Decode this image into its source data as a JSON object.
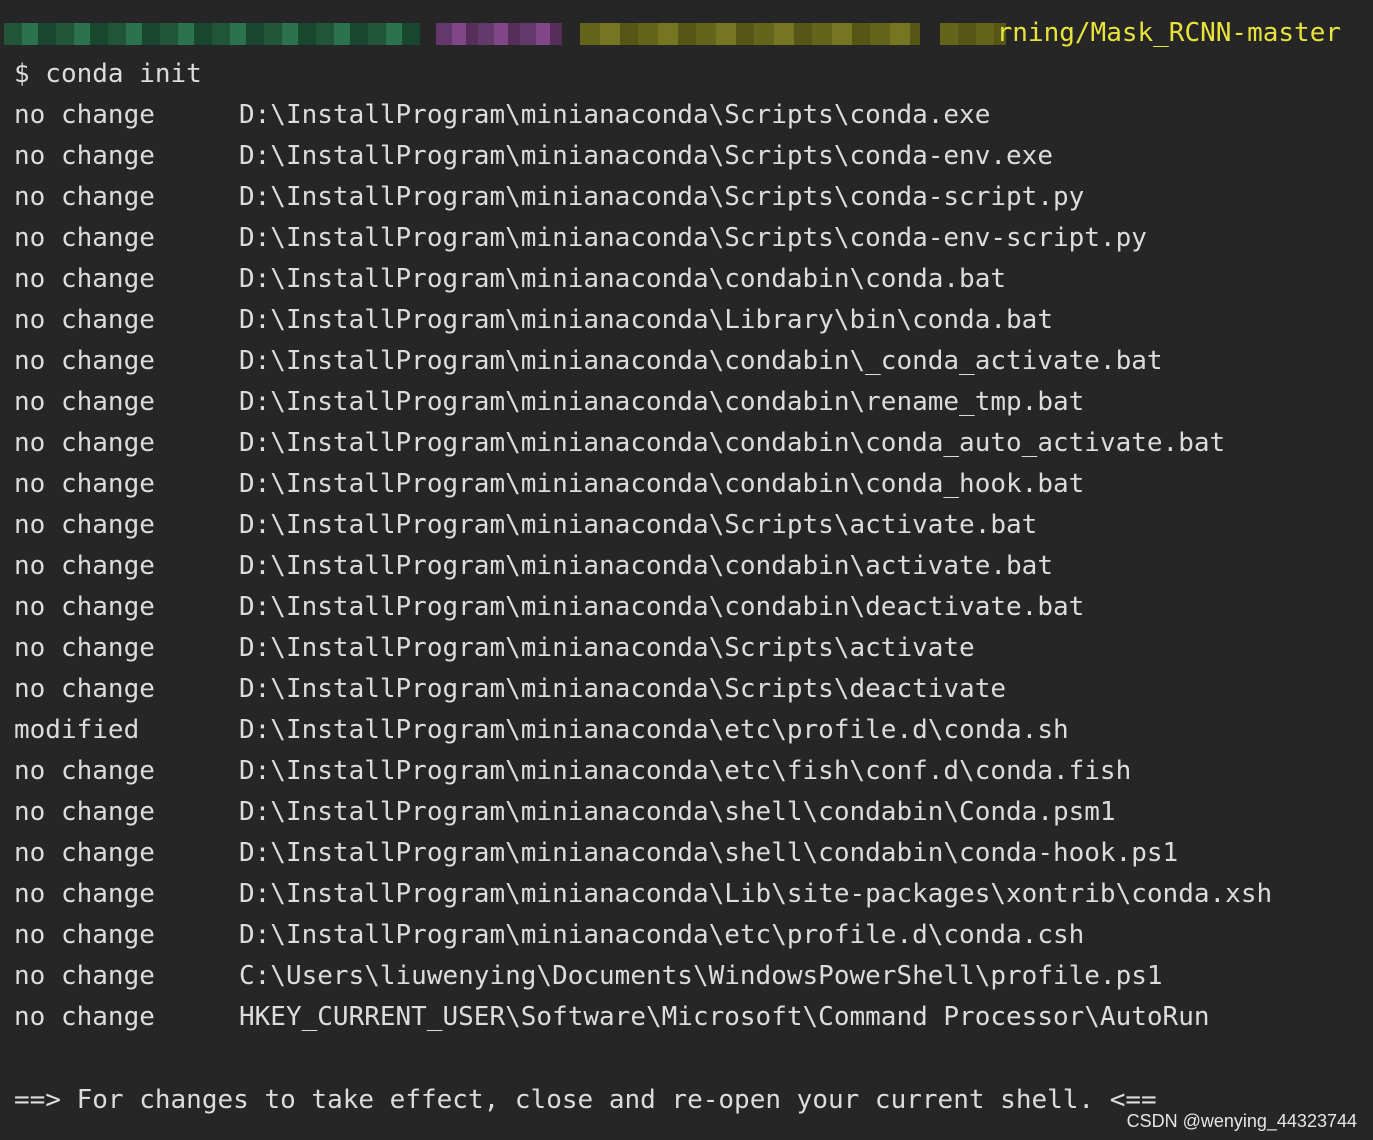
{
  "header": {
    "cwd_visible": "rning/Mask_RCNN-master",
    "cwd_color": "#e8e23a"
  },
  "command": "$ conda init",
  "entries": [
    {
      "status": "no change",
      "path": "D:\\InstallProgram\\minianaconda\\Scripts\\conda.exe"
    },
    {
      "status": "no change",
      "path": "D:\\InstallProgram\\minianaconda\\Scripts\\conda-env.exe"
    },
    {
      "status": "no change",
      "path": "D:\\InstallProgram\\minianaconda\\Scripts\\conda-script.py"
    },
    {
      "status": "no change",
      "path": "D:\\InstallProgram\\minianaconda\\Scripts\\conda-env-script.py"
    },
    {
      "status": "no change",
      "path": "D:\\InstallProgram\\minianaconda\\condabin\\conda.bat"
    },
    {
      "status": "no change",
      "path": "D:\\InstallProgram\\minianaconda\\Library\\bin\\conda.bat"
    },
    {
      "status": "no change",
      "path": "D:\\InstallProgram\\minianaconda\\condabin\\_conda_activate.bat"
    },
    {
      "status": "no change",
      "path": "D:\\InstallProgram\\minianaconda\\condabin\\rename_tmp.bat"
    },
    {
      "status": "no change",
      "path": "D:\\InstallProgram\\minianaconda\\condabin\\conda_auto_activate.bat"
    },
    {
      "status": "no change",
      "path": "D:\\InstallProgram\\minianaconda\\condabin\\conda_hook.bat"
    },
    {
      "status": "no change",
      "path": "D:\\InstallProgram\\minianaconda\\Scripts\\activate.bat"
    },
    {
      "status": "no change",
      "path": "D:\\InstallProgram\\minianaconda\\condabin\\activate.bat"
    },
    {
      "status": "no change",
      "path": "D:\\InstallProgram\\minianaconda\\condabin\\deactivate.bat"
    },
    {
      "status": "no change",
      "path": "D:\\InstallProgram\\minianaconda\\Scripts\\activate"
    },
    {
      "status": "no change",
      "path": "D:\\InstallProgram\\minianaconda\\Scripts\\deactivate"
    },
    {
      "status": "modified",
      "path": "D:\\InstallProgram\\minianaconda\\etc\\profile.d\\conda.sh"
    },
    {
      "status": "no change",
      "path": "D:\\InstallProgram\\minianaconda\\etc\\fish\\conf.d\\conda.fish"
    },
    {
      "status": "no change",
      "path": "D:\\InstallProgram\\minianaconda\\shell\\condabin\\Conda.psm1"
    },
    {
      "status": "no change",
      "path": "D:\\InstallProgram\\minianaconda\\shell\\condabin\\conda-hook.ps1"
    },
    {
      "status": "no change",
      "path": "D:\\InstallProgram\\minianaconda\\Lib\\site-packages\\xontrib\\conda.xsh"
    },
    {
      "status": "no change",
      "path": "D:\\InstallProgram\\minianaconda\\etc\\profile.d\\conda.csh"
    },
    {
      "status": "no change",
      "path": "C:\\Users\\liuwenying\\Documents\\WindowsPowerShell\\profile.ps1"
    },
    {
      "status": "no change",
      "path": "HKEY_CURRENT_USER\\Software\\Microsoft\\Command Processor\\AutoRun"
    }
  ],
  "footer_message": "==> For changes to take effect, close and re-open your current shell. <==",
  "watermark": "CSDN @wenying_44323744",
  "colors": {
    "background": "#262626",
    "text": "#dcdcdc"
  }
}
